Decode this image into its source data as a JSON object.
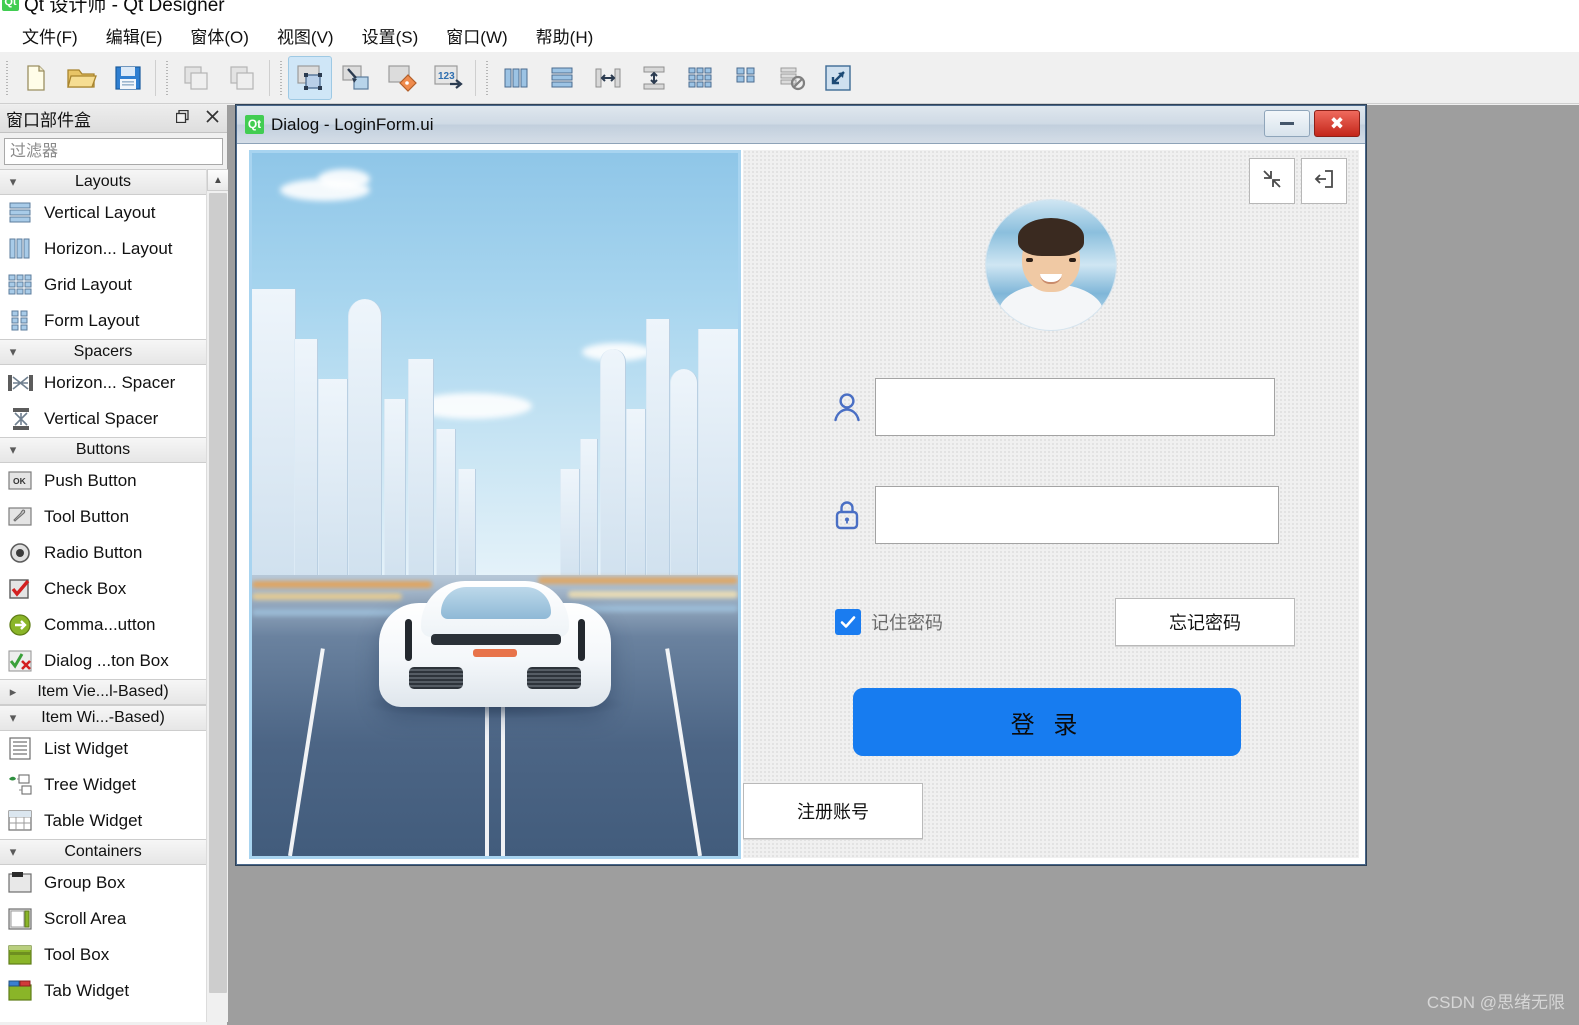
{
  "app": {
    "title": "Qt 设计师 - Qt Designer",
    "logo_text": "Qt"
  },
  "menubar": {
    "items": [
      {
        "label": "文件(F)",
        "name": "menu-file"
      },
      {
        "label": "编辑(E)",
        "name": "menu-edit"
      },
      {
        "label": "窗体(O)",
        "name": "menu-form"
      },
      {
        "label": "视图(V)",
        "name": "menu-view"
      },
      {
        "label": "设置(S)",
        "name": "menu-settings"
      },
      {
        "label": "窗口(W)",
        "name": "menu-window"
      },
      {
        "label": "帮助(H)",
        "name": "menu-help"
      }
    ]
  },
  "toolbar": {
    "buttons": [
      {
        "icon": "new-file-icon",
        "selected": false
      },
      {
        "icon": "open-folder-icon",
        "selected": false
      },
      {
        "icon": "save-icon",
        "selected": false
      },
      {
        "icon": "copy-icon",
        "selected": false
      },
      {
        "icon": "paste-icon",
        "selected": false
      },
      {
        "icon": "edit-widgets-icon",
        "selected": true
      },
      {
        "icon": "edit-signals-slots-icon",
        "selected": false
      },
      {
        "icon": "edit-buddies-icon",
        "selected": false
      },
      {
        "icon": "edit-tab-order-icon",
        "selected": false
      },
      {
        "icon": "layout-horizontally-icon",
        "selected": false
      },
      {
        "icon": "layout-vertically-icon",
        "selected": false
      },
      {
        "icon": "layout-splitter-horizontal-icon",
        "selected": false
      },
      {
        "icon": "layout-splitter-vertical-icon",
        "selected": false
      },
      {
        "icon": "layout-grid-icon",
        "selected": false
      },
      {
        "icon": "layout-form-icon",
        "selected": false
      },
      {
        "icon": "break-layout-icon",
        "selected": false
      },
      {
        "icon": "adjust-size-icon",
        "selected": false
      }
    ]
  },
  "widgetbox": {
    "title": "窗口部件盒",
    "float_icon": "restore-icon",
    "close_icon": "close-icon",
    "filter_placeholder": "过滤器",
    "filter_value": "",
    "groups": [
      {
        "label": "Layouts",
        "expanded": true,
        "items": [
          {
            "label": "Vertical Layout",
            "icon": "vertical-layout-icon"
          },
          {
            "label": "Horizon... Layout",
            "icon": "horizontal-layout-icon"
          },
          {
            "label": "Grid Layout",
            "icon": "grid-layout-icon"
          },
          {
            "label": "Form Layout",
            "icon": "form-layout-icon"
          }
        ]
      },
      {
        "label": "Spacers",
        "expanded": true,
        "items": [
          {
            "label": "Horizon... Spacer",
            "icon": "horizontal-spacer-icon"
          },
          {
            "label": "Vertical Spacer",
            "icon": "vertical-spacer-icon"
          }
        ]
      },
      {
        "label": "Buttons",
        "expanded": true,
        "items": [
          {
            "label": "Push Button",
            "icon": "push-button-icon"
          },
          {
            "label": "Tool Button",
            "icon": "tool-button-icon"
          },
          {
            "label": "Radio Button",
            "icon": "radio-button-icon"
          },
          {
            "label": "Check Box",
            "icon": "check-box-icon"
          },
          {
            "label": "Comma...utton",
            "icon": "command-link-button-icon"
          },
          {
            "label": "Dialog ...ton Box",
            "icon": "dialog-button-box-icon"
          }
        ]
      },
      {
        "label": "Item Vie...l-Based)",
        "expanded": false,
        "items": []
      },
      {
        "label": "Item Wi...-Based)",
        "expanded": true,
        "items": [
          {
            "label": "List Widget",
            "icon": "list-widget-icon"
          },
          {
            "label": "Tree Widget",
            "icon": "tree-widget-icon"
          },
          {
            "label": "Table Widget",
            "icon": "table-widget-icon"
          }
        ]
      },
      {
        "label": "Containers",
        "expanded": true,
        "items": [
          {
            "label": "Group Box",
            "icon": "group-box-icon"
          },
          {
            "label": "Scroll Area",
            "icon": "scroll-area-icon"
          },
          {
            "label": "Tool Box",
            "icon": "tool-box-icon"
          },
          {
            "label": "Tab Widget",
            "icon": "tab-widget-icon"
          }
        ]
      }
    ]
  },
  "form_window": {
    "title": "Dialog - LoginForm.ui",
    "badge_text": "Qt",
    "minimize_icon": "minimize-icon",
    "close_icon": "close-icon"
  },
  "login_form": {
    "banner_alt": "futuristic-city-car-illustration",
    "top_tools": [
      {
        "icon": "collapse-arrows-icon",
        "name": "minimize-tool-button"
      },
      {
        "icon": "exit-icon",
        "name": "exit-tool-button"
      }
    ],
    "avatar": "user-avatar-photo",
    "username": {
      "icon": "user-icon",
      "value": "",
      "placeholder": ""
    },
    "password": {
      "icon": "lock-icon",
      "value": "",
      "placeholder": ""
    },
    "remember": {
      "label": "记住密码",
      "checked": true,
      "accent": "#1a7cf0"
    },
    "forgot_label": "忘记密码",
    "login_label": "登 录",
    "login_color": "#177cf0",
    "register_label": "注册账号"
  },
  "watermark": "CSDN @思绪无限"
}
